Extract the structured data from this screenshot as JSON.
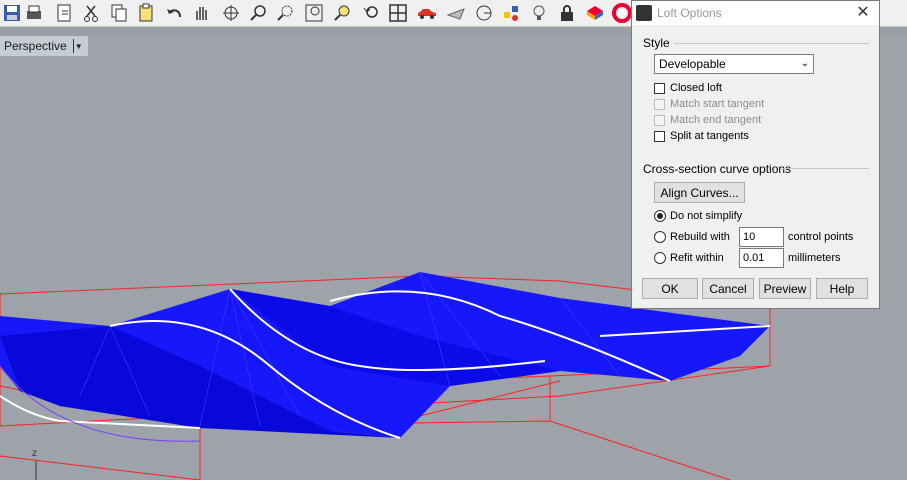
{
  "toolbar": {
    "icons": [
      "save-icon",
      "print-icon",
      "copy-to-layer-icon",
      "cut-icon",
      "copy-icon",
      "paste-icon",
      "undo-icon",
      "pan-icon",
      "rotate-view-icon",
      "zoom-icon",
      "zoom-window-icon",
      "zoom-extents-icon",
      "zoom-selected-icon",
      "undo-view-icon",
      "four-viewports-icon",
      "car-icon",
      "plane-icon",
      "osnap-icon",
      "points-icon",
      "light-icon",
      "lock-icon",
      "material-icon",
      "color-wheel-icon"
    ]
  },
  "viewport": {
    "name": "Perspective",
    "axis_label": "z",
    "colors": {
      "surface": "#1010ff",
      "bbox": "#ff1a1a",
      "curves": "#ffffff",
      "background": "#9da3a9"
    }
  },
  "dialog": {
    "title": "Loft Options",
    "style": {
      "group_label": "Style",
      "selected": "Developable",
      "closed_loft": "Closed loft",
      "match_start": "Match start tangent",
      "match_end": "Match end tangent",
      "split_at_tangents": "Split at tangents"
    },
    "cross_section": {
      "group_label": "Cross-section curve options",
      "align_button": "Align Curves...",
      "do_not_simplify": "Do not simplify",
      "rebuild_with": "Rebuild with",
      "rebuild_value": "10",
      "rebuild_unit": "control points",
      "refit_within": "Refit within",
      "refit_value": "0.01",
      "refit_unit": "millimeters"
    },
    "buttons": {
      "ok": "OK",
      "cancel": "Cancel",
      "preview": "Preview",
      "help": "Help"
    }
  }
}
